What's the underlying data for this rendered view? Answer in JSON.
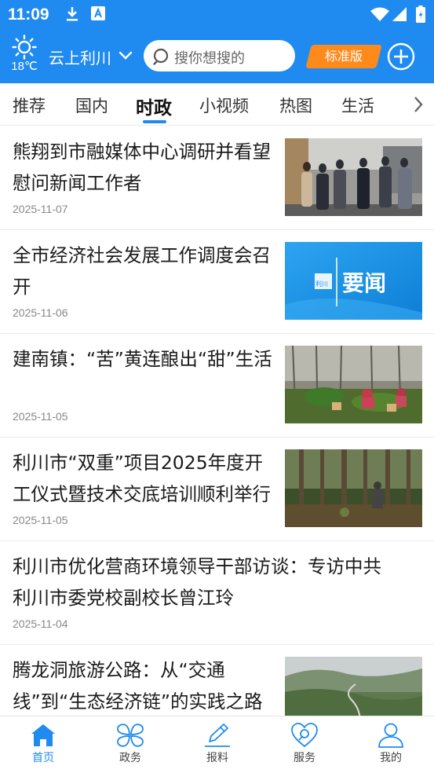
{
  "status_bar": {
    "time": "11:09"
  },
  "header": {
    "temperature": "18℃",
    "city": "云上利川",
    "search_placeholder": "搜你想搜的",
    "edition_label": "标准版",
    "accent_color": "#1f8bf0"
  },
  "tabs": [
    {
      "label": "推荐",
      "active": false
    },
    {
      "label": "国内",
      "active": false
    },
    {
      "label": "时政",
      "active": true
    },
    {
      "label": "小视频",
      "active": false
    },
    {
      "label": "热图",
      "active": false
    },
    {
      "label": "生活",
      "active": false
    }
  ],
  "news": [
    {
      "title": "熊翔到市融媒体中心调研并看望慰问新闻工作者",
      "date": "2025-11-07",
      "thumb": "meeting-photo"
    },
    {
      "title": "全市经济社会发展工作调度会召开",
      "date": "2025-11-06",
      "thumb": "yaowen-banner",
      "thumb_tag": "利川",
      "thumb_text": "要闻"
    },
    {
      "title": "建南镇：“苦”黄连酿出“甜”生活",
      "date": "2025-11-05",
      "thumb": "farm-photo"
    },
    {
      "title": "利川市“双重”项目2025年度开工仪式暨技术交底培训顺利举行",
      "date": "2025-11-05",
      "thumb": "forest-photo"
    },
    {
      "title": "利川市优化营商环境领导干部访谈：专访中共利川市委党校副校长曾江玲",
      "date": "2025-11-04"
    },
    {
      "title": "腾龙洞旅游公路：从“交通线”到“生态经济链”的实践之路",
      "date": "",
      "thumb": "mountain-road-photo"
    }
  ],
  "bottom_nav": [
    {
      "label": "首页",
      "icon": "home-icon",
      "active": true
    },
    {
      "label": "政务",
      "icon": "clover-icon",
      "active": false
    },
    {
      "label": "报料",
      "icon": "pen-icon",
      "active": false
    },
    {
      "label": "服务",
      "icon": "heart-hand-icon",
      "active": false
    },
    {
      "label": "我的",
      "icon": "user-icon",
      "active": false
    }
  ]
}
